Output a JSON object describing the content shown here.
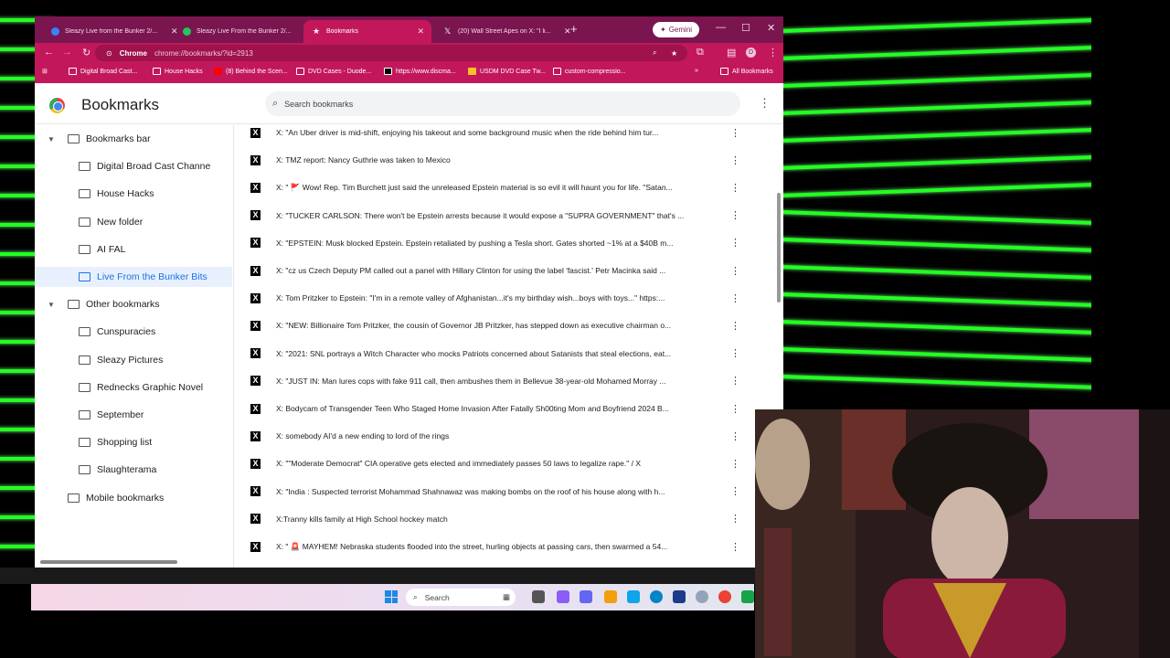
{
  "tabs": [
    {
      "title": "Sleazy Live from the Bunker 2/...",
      "color": "#3b82f6"
    },
    {
      "title": "Sleazy Live From the Bunker 2/...",
      "color": "#22c55e"
    },
    {
      "title": "Bookmarks",
      "color": "#ffffff"
    },
    {
      "title": "(20) Wall Street Apes on X: \"I li...",
      "color": "#000000"
    }
  ],
  "window": {
    "gemini": "Gemini"
  },
  "omnibox": {
    "site": "Chrome",
    "url": "chrome://bookmarks/?id=2913"
  },
  "bookmarks_bar": [
    "Digital Broad Cast...",
    "House Hacks",
    "(8) Behind the Scen...",
    "DVD Cases - Duode...",
    "https://www.discma...",
    "USDM DVD Case Tw...",
    "custom-compressio..."
  ],
  "all_bookmarks": "All Bookmarks",
  "page": {
    "title": "Bookmarks",
    "search_placeholder": "Search bookmarks"
  },
  "sidebar": [
    {
      "label": "Bookmarks bar",
      "level": 0,
      "expanded": true
    },
    {
      "label": "Digital Broad Cast Channe",
      "level": 1
    },
    {
      "label": "House Hacks",
      "level": 1
    },
    {
      "label": "New folder",
      "level": 1
    },
    {
      "label": "AI FAL",
      "level": 1
    },
    {
      "label": "Live From the Bunker Bits",
      "level": 1,
      "selected": true
    },
    {
      "label": "Other bookmarks",
      "level": 0,
      "expanded": true
    },
    {
      "label": "Cunspuracies",
      "level": 1
    },
    {
      "label": "Sleazy Pictures",
      "level": 1
    },
    {
      "label": "Rednecks Graphic Novel",
      "level": 1
    },
    {
      "label": "September",
      "level": 1
    },
    {
      "label": "Shopping list",
      "level": 1
    },
    {
      "label": "Slaughterama",
      "level": 1
    },
    {
      "label": "Mobile bookmarks",
      "level": 0
    }
  ],
  "bookmarks": [
    "X: \"An Uber driver is mid-shift, enjoying his takeout and some background music when the ride behind him tur...",
    "X: TMZ report: Nancy Guthrie was taken to Mexico",
    "X: \" 🚩 Wow! Rep. Tim Burchett just said the unreleased Epstein material is so evil it will haunt you for life. \"Satan...",
    "X: \"TUCKER CARLSON: There won't be Epstein arrests because it would expose a \"SUPRA GOVERNMENT\" that's ...",
    "X: \"EPSTEIN: Musk blocked Epstein. Epstein retaliated by pushing a Tesla short. Gates shorted ~1% at a $40B m...",
    "X: \"cz us Czech Deputy PM called out a panel with Hillary Clinton for using the label 'fascist.' Petr Macinka said ...",
    "X: Tom Pritzker to Epstein: \"I'm in a remote valley of Afghanistan...it's my birthday wish...boys with toys...\" https:...",
    "X: \"NEW: Billionaire Tom Pritzker, the cousin of Governor JB Pritzker, has stepped down as executive chairman o...",
    "X: \"2021: SNL portrays a Witch Character who mocks Patriots concerned about Satanists that steal elections, eat...",
    "X: \"JUST IN: Man lures cops with fake 911 call, then ambushes them in Bellevue 38-year-old Mohamed Morray ...",
    "X: Bodycam of Transgender Teen Who Staged Home Invasion After Fatally Sh00ting Mom and Boyfriend 2024 B...",
    "X: somebody AI'd a new ending to lord of the rings",
    "X: \"\"Moderate Democrat\" CIA operative gets elected and immediately passes 50 laws to legalize rape.\" / X",
    "X: \"India : Suspected terrorist Mohammad Shahnawaz was making bombs on the roof of his house along with h...",
    "X:Tranny kills family at High School hockey match",
    "X: \" 🚨 MAYHEM! Nebraska students flooded into the street, hurling objects at passing cars, then swarmed a 54..."
  ],
  "taskbar": {
    "search_label": "Search"
  },
  "colors": {
    "accent": "#c2185b",
    "tabstrip": "#7a1550",
    "selected": "#1a73e8",
    "neon": "#22ff22"
  }
}
